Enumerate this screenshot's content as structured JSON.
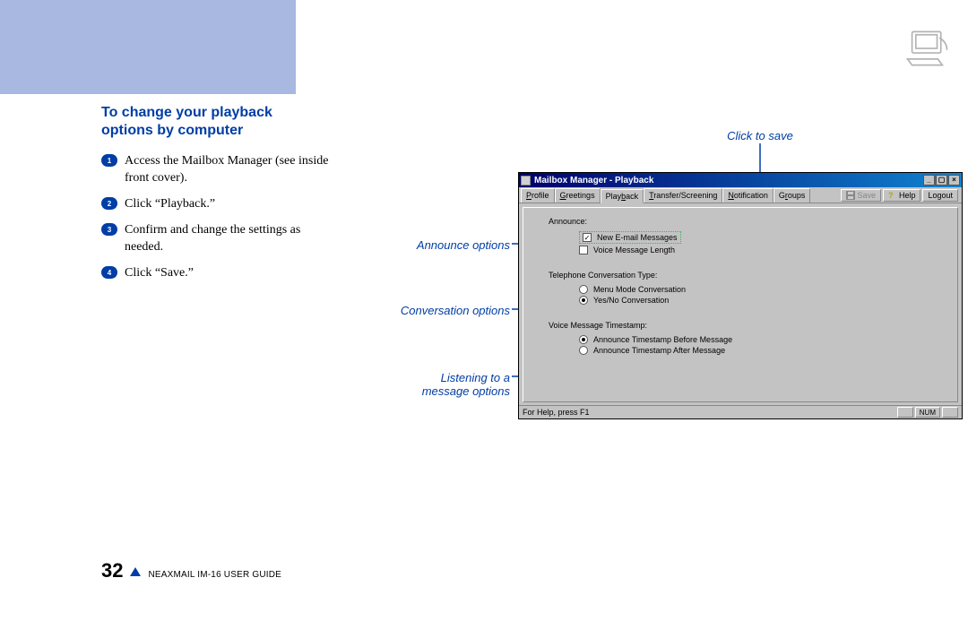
{
  "section_title_line1": "To change your playback",
  "section_title_line2": "options by computer",
  "steps": [
    "Access the Mailbox Manager (see inside front cover).",
    "Click “Playback.”",
    "Confirm and change the settings as needed.",
    "Click “Save.”"
  ],
  "annotations": {
    "click_to_save": "Click to save",
    "announce_options": "Announce options",
    "conversation_options": "Conversation options",
    "listening_line1": "Listening to a",
    "listening_line2": "message options"
  },
  "screenshot": {
    "window_title": "Mailbox Manager - Playback",
    "tabs": [
      "Profile",
      "Greetings",
      "Playback",
      "Transfer/Screening",
      "Notification",
      "Groups"
    ],
    "buttons": {
      "save": "Save",
      "help": "Help",
      "logout": "Logout"
    },
    "announce_label": "Announce:",
    "announce_options": [
      {
        "label": "New E-mail Messages",
        "checked": true
      },
      {
        "label": "Voice Message Length",
        "checked": false
      }
    ],
    "telephone_label": "Telephone Conversation Type:",
    "telephone_options": [
      {
        "label": "Menu Mode Conversation",
        "selected": false
      },
      {
        "label": "Yes/No Conversation",
        "selected": true
      }
    ],
    "timestamp_label": "Voice Message Timestamp:",
    "timestamp_options": [
      {
        "label": "Announce Timestamp Before Message",
        "selected": true
      },
      {
        "label": "Announce Timestamp After Message",
        "selected": false
      }
    ],
    "status_text": "For Help, press F1",
    "status_right": "NUM"
  },
  "footer": {
    "page_number": "32",
    "guide": "NEAXMAIL IM-16 USER GUIDE"
  }
}
